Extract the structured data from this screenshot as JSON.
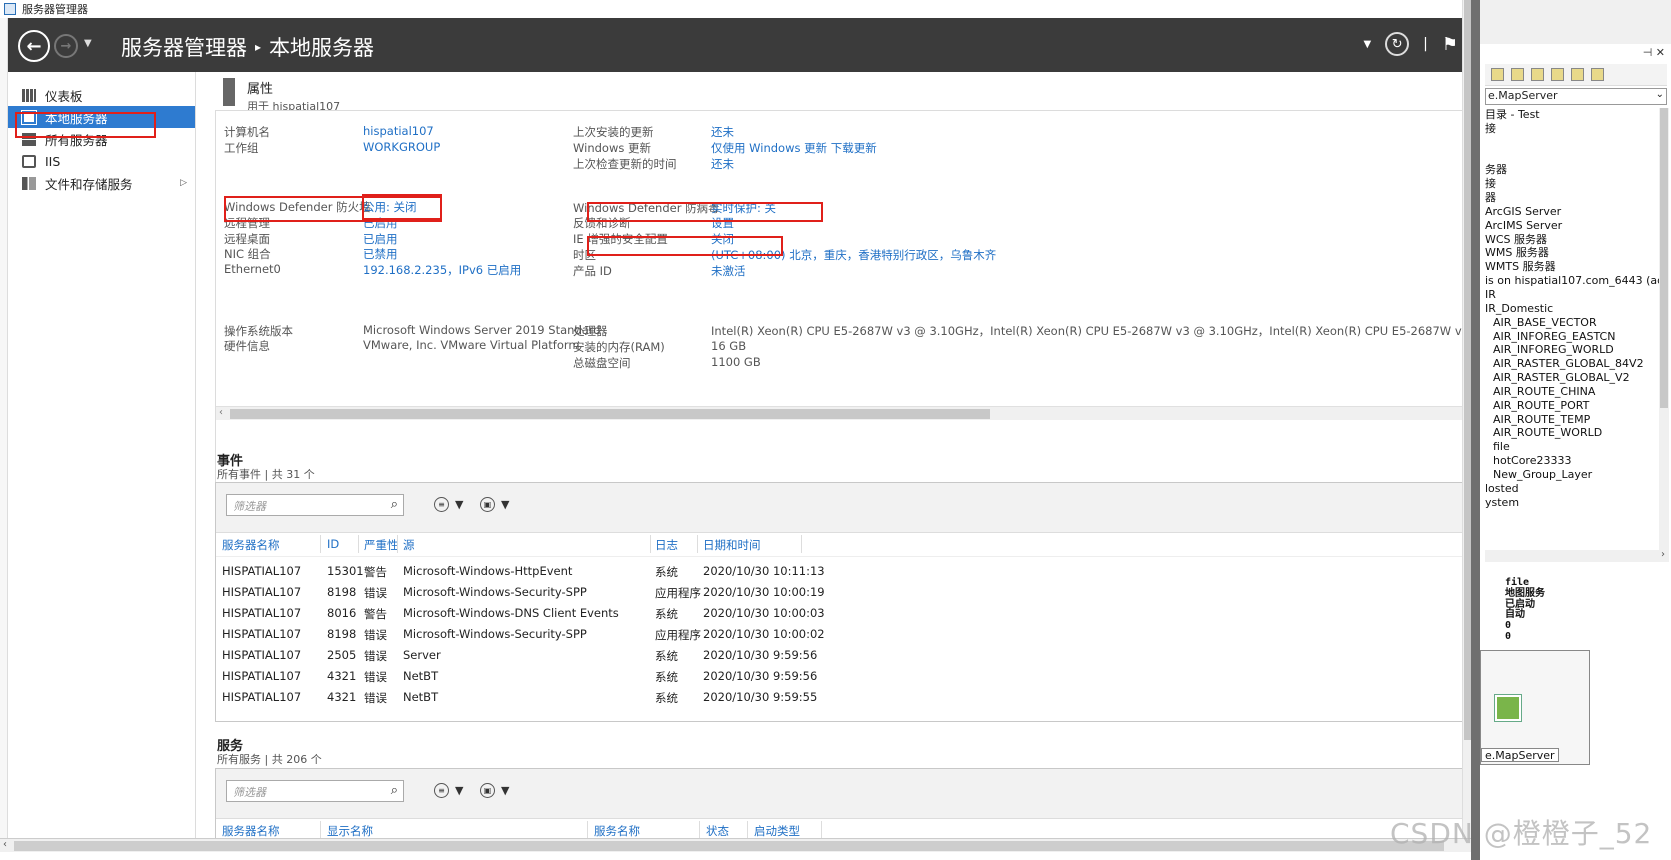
{
  "window": {
    "title": "服务器管理器"
  },
  "header": {
    "breadcrumb_root": "服务器管理器",
    "breadcrumb_sep": "▸",
    "breadcrumb_current": "本地服务器",
    "separator": "|"
  },
  "sidebar": {
    "items": [
      {
        "label": "仪表板",
        "icon": "dashboard-icon"
      },
      {
        "label": "本地服务器",
        "icon": "server-icon",
        "active": true
      },
      {
        "label": "所有服务器",
        "icon": "servers-icon"
      },
      {
        "label": "IIS",
        "icon": "iis-icon"
      },
      {
        "label": "文件和存储服务",
        "icon": "storage-icon",
        "expandable": true
      }
    ]
  },
  "properties": {
    "title": "属性",
    "subtitle": "用于 hispatial107",
    "left": [
      {
        "label": "计算机名",
        "value": "hispatial107"
      },
      {
        "label": "工作组",
        "value": "WORKGROUP"
      },
      {
        "label": "Windows Defender 防火墙",
        "value": "公用: 关闭"
      },
      {
        "label": "远程管理",
        "value": "已启用"
      },
      {
        "label": "远程桌面",
        "value": "已启用"
      },
      {
        "label": "NIC 组合",
        "value": "已禁用"
      },
      {
        "label": "Ethernet0",
        "value": "192.168.2.235，IPv6 已启用"
      },
      {
        "label": "操作系统版本",
        "value": "Microsoft Windows Server 2019 Standard"
      },
      {
        "label": "硬件信息",
        "value": "VMware, Inc. VMware Virtual Platform"
      }
    ],
    "right": [
      {
        "label": "上次安装的更新",
        "value": "还未"
      },
      {
        "label": "Windows 更新",
        "value": "仅使用 Windows 更新 下载更新"
      },
      {
        "label": "上次检查更新的时间",
        "value": "还未"
      },
      {
        "label": "Windows Defender 防病毒",
        "value": "实时保护: 关"
      },
      {
        "label": "反馈和诊断",
        "value": "设置"
      },
      {
        "label": "IE 增强的安全配置",
        "value": "关闭"
      },
      {
        "label": "时区",
        "value": "(UTC+08:00) 北京，重庆，香港特别行政区，乌鲁木齐"
      },
      {
        "label": "产品 ID",
        "value": "未激活"
      },
      {
        "label": "处理器",
        "value": "Intel(R) Xeon(R) CPU E5-2687W v3 @ 3.10GHz，Intel(R) Xeon(R) CPU E5-2687W v3 @ 3.10GHz，Intel(R) Xeon(R) CPU E5-2687W v3 @ 3.10GHz,"
      },
      {
        "label": "安装的内存(RAM)",
        "value": "16 GB"
      },
      {
        "label": "总磁盘空间",
        "value": "1100 GB"
      }
    ]
  },
  "events": {
    "title": "事件",
    "subtitle": "所有事件 | 共 31 个",
    "filter_placeholder": "筛选器",
    "columns": [
      "服务器名称",
      "ID",
      "严重性",
      "源",
      "日志",
      "日期和时间"
    ],
    "rows": [
      [
        "HISPATIAL107",
        "15301",
        "警告",
        "Microsoft-Windows-HttpEvent",
        "系统",
        "2020/10/30 10:11:13"
      ],
      [
        "HISPATIAL107",
        "8198",
        "错误",
        "Microsoft-Windows-Security-SPP",
        "应用程序",
        "2020/10/30 10:00:19"
      ],
      [
        "HISPATIAL107",
        "8016",
        "警告",
        "Microsoft-Windows-DNS Client Events",
        "系统",
        "2020/10/30 10:00:03"
      ],
      [
        "HISPATIAL107",
        "8198",
        "错误",
        "Microsoft-Windows-Security-SPP",
        "应用程序",
        "2020/10/30 10:00:02"
      ],
      [
        "HISPATIAL107",
        "2505",
        "错误",
        "Server",
        "系统",
        "2020/10/30 9:59:56"
      ],
      [
        "HISPATIAL107",
        "4321",
        "错误",
        "NetBT",
        "系统",
        "2020/10/30 9:59:56"
      ],
      [
        "HISPATIAL107",
        "4321",
        "错误",
        "NetBT",
        "系统",
        "2020/10/30 9:59:55"
      ]
    ]
  },
  "services": {
    "title": "服务",
    "subtitle": "所有服务 | 共 206 个",
    "filter_placeholder": "筛选器",
    "columns": [
      "服务器名称",
      "显示名称",
      "服务名称",
      "状态",
      "启动类型"
    ]
  },
  "right_panel": {
    "combo": "e.MapServer",
    "tree": [
      "目录 - Test",
      "接",
      "",
      "",
      "务器",
      "接",
      "器",
      "ArcGIS Server",
      "ArcIMS Server",
      "WCS 服务器",
      "WMS 服务器",
      "WMTS 服务器",
      "is on hispatial107.com_6443 (adm",
      "IR",
      "IR_Domestic",
      "AIR_BASE_VECTOR",
      "AIR_INFOREG_EASTCN",
      "AIR_INFOREG_WORLD",
      "AIR_RASTER_GLOBAL_84V2",
      "AIR_RASTER_GLOBAL_V2",
      "AIR_ROUTE_CHINA",
      "AIR_ROUTE_PORT",
      "AIR_ROUTE_TEMP",
      "AIR_ROUTE_WORLD",
      "file",
      "hotCore23333",
      "New_Group_Layer",
      "losted",
      "ystem"
    ],
    "detail": [
      "file",
      "地图服务",
      "已启动",
      "自动",
      "0",
      "0"
    ],
    "selected_label": "e.MapServer"
  },
  "watermark": "CSDN @橙橙子_52"
}
